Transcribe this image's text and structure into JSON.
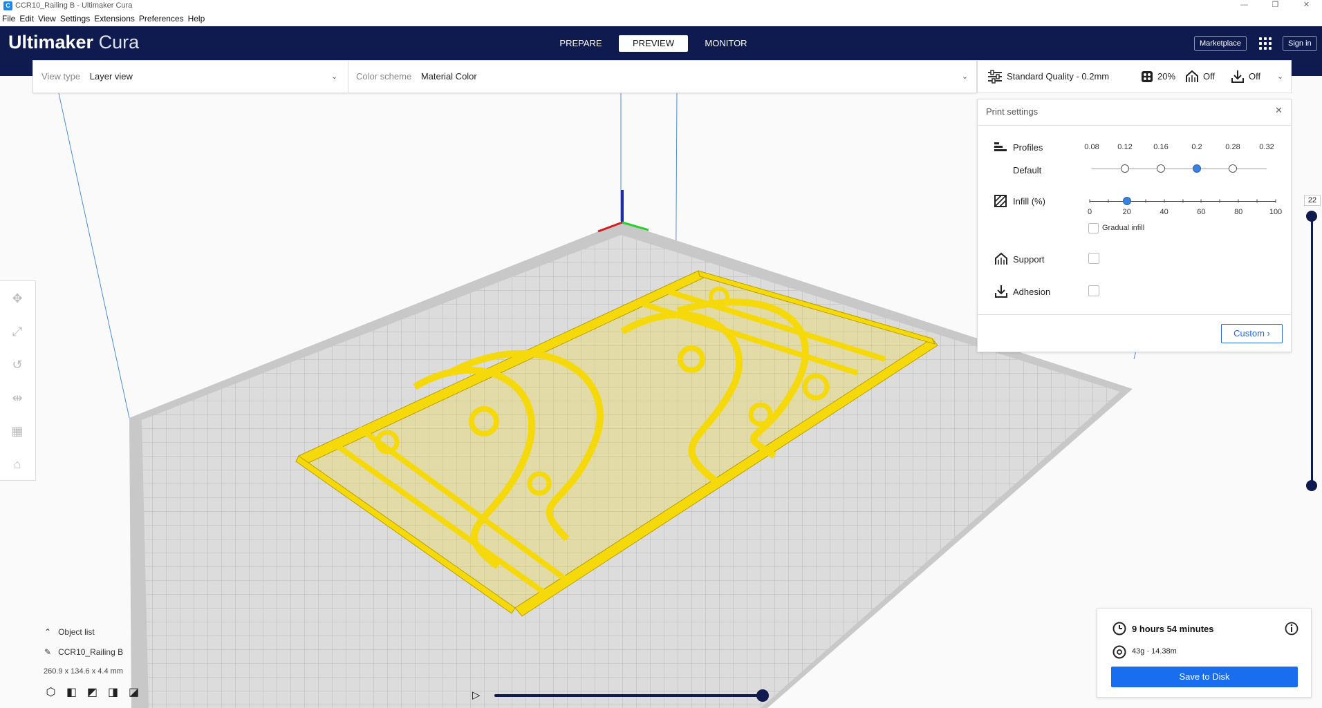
{
  "window": {
    "title": "CCR10_Railing B - Ultimaker Cura",
    "app_icon": "C",
    "controls": {
      "minimize": "—",
      "maximize": "❐",
      "close": "✕"
    }
  },
  "menu": [
    "File",
    "Edit",
    "View",
    "Settings",
    "Extensions",
    "Preferences",
    "Help"
  ],
  "header": {
    "logo_bold": "Ultimaker",
    "logo_light": "Cura",
    "tabs": [
      "PREPARE",
      "PREVIEW",
      "MONITOR"
    ],
    "active_tab": "PREVIEW",
    "marketplace": "Marketplace",
    "signin": "Sign in",
    "brand_color": "#0f1a4f"
  },
  "viewbar": {
    "view_type_label": "View type",
    "view_type_value": "Layer view",
    "color_scheme_label": "Color scheme",
    "color_scheme_value": "Material Color"
  },
  "print_header": {
    "quality": "Standard Quality - 0.2mm",
    "infill": "20%",
    "support": "Off",
    "adhesion": "Off"
  },
  "print_settings": {
    "title": "Print settings",
    "profiles_label": "Profiles",
    "default_label": "Default",
    "profile_ticks": [
      "0.08",
      "0.12",
      "0.16",
      "0.2",
      "0.28",
      "0.32"
    ],
    "selected_profile": "0.2",
    "infill_label": "Infill (%)",
    "infill_ticks": [
      "0",
      "20",
      "40",
      "60",
      "80",
      "100"
    ],
    "infill_value": 20,
    "gradual_infill": "Gradual infill",
    "support_label": "Support",
    "adhesion_label": "Adhesion",
    "custom_button": "Custom"
  },
  "layer_slider": {
    "value": "22"
  },
  "object_list": {
    "toggle_label": "Object list",
    "object_name": "CCR10_Railing B",
    "dimensions": "260.9 x 134.6 x 4.4 mm"
  },
  "print_info": {
    "time": "9 hours 54 minutes",
    "material": "43g · 14.38m",
    "save_button": "Save to Disk",
    "accent": "#196ef0"
  },
  "model": {
    "color": "#f5d90a"
  }
}
